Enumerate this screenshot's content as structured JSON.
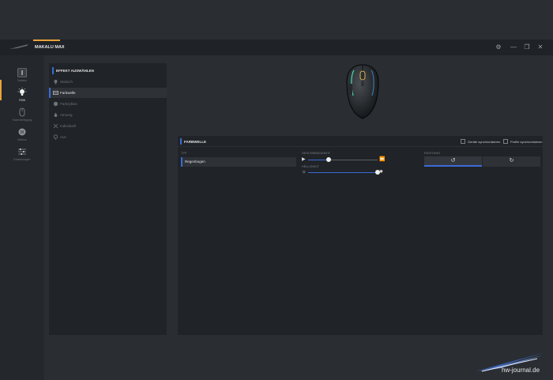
{
  "header": {
    "device_name": "MAKALU MAX",
    "window_controls": [
      "gear-icon",
      "minimize-icon",
      "maximize-icon",
      "close-icon"
    ]
  },
  "sidebar": {
    "items": [
      {
        "label": "Tastatur",
        "icon": "key-icon"
      },
      {
        "label": "RGB",
        "icon": "bulb-icon",
        "active": true
      },
      {
        "label": "Tastenbelegung",
        "icon": "mouse-icon"
      },
      {
        "label": "Makros",
        "icon": "macro-icon"
      },
      {
        "label": "Einstellungen",
        "icon": "sliders-icon"
      }
    ]
  },
  "effects": {
    "title": "EFFEKT AUSWÄHLEN",
    "items": [
      {
        "label": "Statisch",
        "icon": "bulb-icon"
      },
      {
        "label": "Farbwelle",
        "icon": "rainbow-icon",
        "selected": true
      },
      {
        "label": "Farbzyklus",
        "icon": "cycle-icon"
      },
      {
        "label": "Atmung",
        "icon": "drop-icon"
      },
      {
        "label": "Individuell",
        "icon": "custom-icon"
      },
      {
        "label": "Aus",
        "icon": "off-icon"
      }
    ]
  },
  "settings": {
    "title": "FARBWELLE",
    "sync_devices_label": "Geräte synchronisieren",
    "sync_profiles_label": "Profile synchronisieren",
    "type_label": "TYP",
    "type_value": "Regenbogen",
    "speed_label": "GESCHWINDIGKEIT",
    "speed_value": 0.3,
    "brightness_label": "HELLIGKEIT",
    "brightness_value": 1.0,
    "direction_label": "RICHTUNG",
    "direction_options": [
      "↺",
      "↻"
    ],
    "direction_selected": 0
  },
  "watermark": {
    "text": "hw-journal.de"
  },
  "colors": {
    "accent_orange": "#e8a33a",
    "accent_blue": "#3a6bd6",
    "background": "#2a2e33",
    "panel": "#202327"
  }
}
